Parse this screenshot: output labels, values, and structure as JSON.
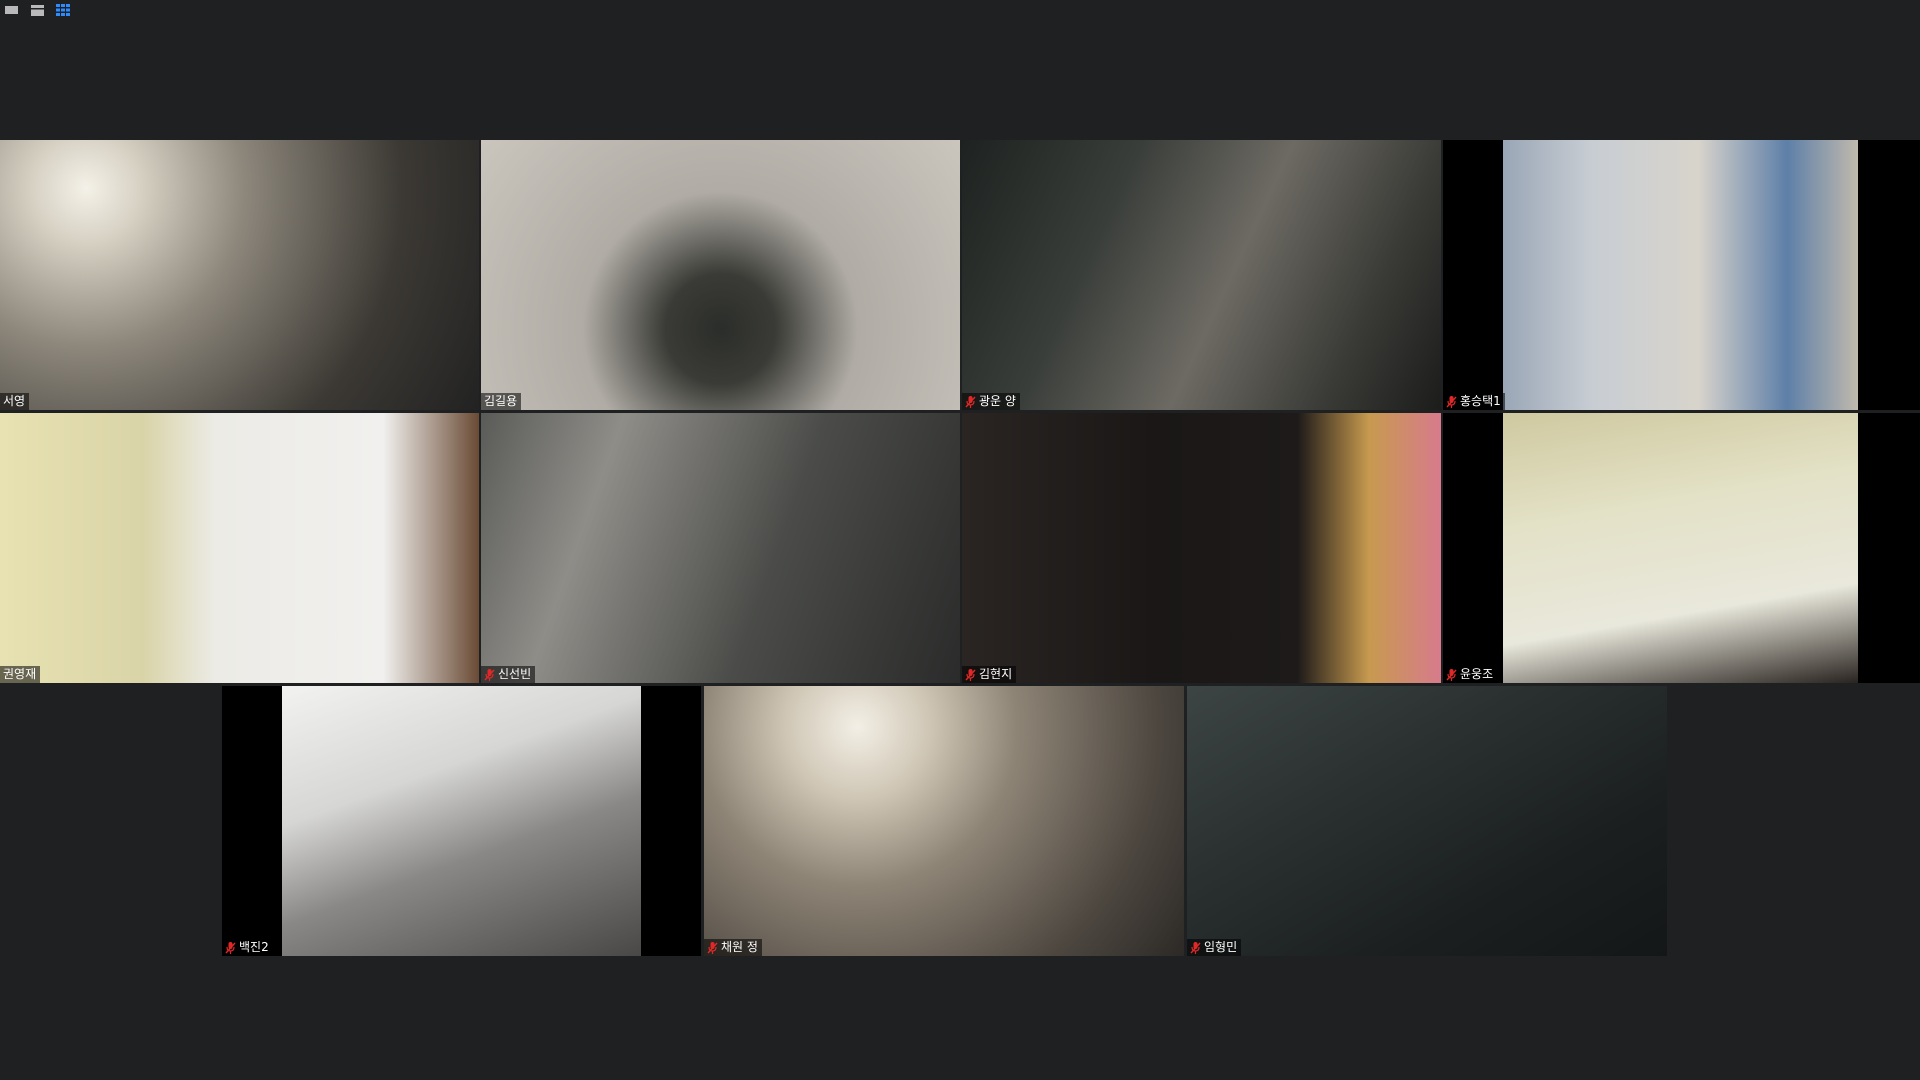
{
  "toolbar": {
    "views": [
      {
        "name": "speaker-view-icon"
      },
      {
        "name": "strip-view-icon"
      },
      {
        "name": "gallery-view-icon",
        "active": true
      }
    ]
  },
  "colors": {
    "background": "#1f2022",
    "accent": "#2d8cff",
    "mute": "#e02828",
    "nametag_text": "#ffffff"
  },
  "participants": [
    {
      "name": "서영",
      "muted": false
    },
    {
      "name": "김길용",
      "muted": false
    },
    {
      "name": "광운 양",
      "muted": true
    },
    {
      "name": "홍승택1",
      "muted": true
    },
    {
      "name": "권영재",
      "muted": false
    },
    {
      "name": "신선빈",
      "muted": true
    },
    {
      "name": "김현지",
      "muted": true
    },
    {
      "name": "윤웅조",
      "muted": true
    },
    {
      "name": "백진2",
      "muted": true
    },
    {
      "name": "채원 정",
      "muted": true
    },
    {
      "name": "임형민",
      "muted": true
    }
  ]
}
